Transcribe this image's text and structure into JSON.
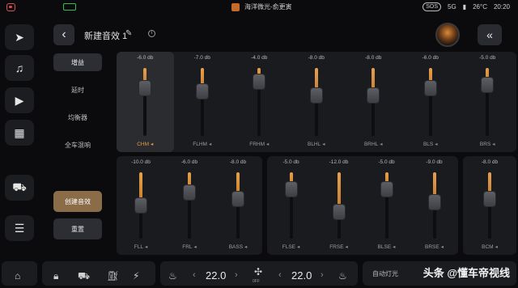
{
  "status": {
    "media_title": "海洋微光-俞更寅",
    "sos": "SOS",
    "network": "5G",
    "temperature": "26°C",
    "time": "20:20"
  },
  "header": {
    "title": "新建音效 1"
  },
  "menu": {
    "items": [
      {
        "label": "增益",
        "active": true
      },
      {
        "label": "延时",
        "active": false
      },
      {
        "label": "均衡器",
        "active": false
      },
      {
        "label": "全车混响",
        "active": false
      }
    ],
    "create_label": "创建音效",
    "reset_label": "重置"
  },
  "gain": {
    "range_db": [
      -20,
      0
    ],
    "top": [
      {
        "id": "CHM",
        "db": -6.0,
        "db_label": "-6.0 db",
        "selected": true
      },
      {
        "id": "FLHM",
        "db": -7.0,
        "db_label": "-7.0 db"
      },
      {
        "id": "FRHM",
        "db": -4.0,
        "db_label": "-4.0 db"
      },
      {
        "id": "BLHL",
        "db": -8.0,
        "db_label": "-8.0 db"
      },
      {
        "id": "BRHL",
        "db": -8.0,
        "db_label": "-8.0 db"
      },
      {
        "id": "BLS",
        "db": -6.0,
        "db_label": "-6.0 db"
      },
      {
        "id": "BRS",
        "db": -5.0,
        "db_label": "-5.0 db"
      }
    ],
    "bottom_left": [
      {
        "id": "FLL",
        "db": -10.0,
        "db_label": "-10.0 db"
      },
      {
        "id": "FRL",
        "db": -6.0,
        "db_label": "-6.0 db"
      },
      {
        "id": "BASS",
        "db": -8.0,
        "db_label": "-8.0 db"
      }
    ],
    "bottom_mid": [
      {
        "id": "FLSE",
        "db": -5.0,
        "db_label": "-5.0 db"
      },
      {
        "id": "FRSE",
        "db": -12.0,
        "db_label": "-12.0 db"
      },
      {
        "id": "BLSE",
        "db": -5.0,
        "db_label": "-5.0 db"
      },
      {
        "id": "BRSE",
        "db": -9.0,
        "db_label": "-9.0 db"
      }
    ],
    "bottom_right": [
      {
        "id": "BCM",
        "db": -8.0,
        "db_label": "-8.0 db"
      }
    ]
  },
  "bottombar": {
    "left_temp": "22.0",
    "right_temp": "22.0",
    "fan_label": "0FF",
    "auto_label": "自动灯光",
    "watermark": "头条 @懂车帝视线"
  },
  "colors": {
    "accent": "#e59a3e",
    "create_button": "#8a6c48"
  }
}
